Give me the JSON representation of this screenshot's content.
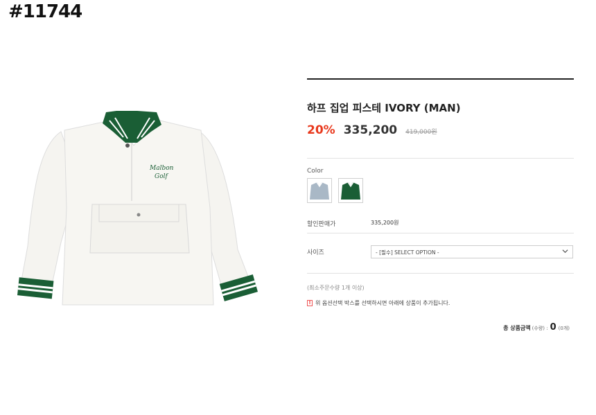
{
  "tag": "#11744",
  "product": {
    "title": "하프 집업 피스테 IVORY (MAN)",
    "discount": "20%",
    "sale_price": "335,200",
    "original_price": "419,000원",
    "image_logo_line1": "Malbon",
    "image_logo_line2": "Golf"
  },
  "color": {
    "label": "Color",
    "swatches": [
      "light-blue-jacket",
      "green-jacket"
    ]
  },
  "discount_price": {
    "label": "할인판매가",
    "value": "335,200원"
  },
  "size": {
    "label": "사이즈",
    "select_value": "- [필수] SELECT OPTION -"
  },
  "notes": {
    "min_qty": "(최소주문수량 1개 이상)",
    "alert_icon": "!",
    "alert_text": "위 옵션선택 박스를 선택하시면 아래에 상품이 추가됩니다."
  },
  "total": {
    "label": "총 상품금액",
    "sub": "(수량) :",
    "value": "0",
    "count": "(0개)"
  },
  "colors": {
    "accent_red": "#e8381c",
    "jacket_green": "#1a5e35",
    "swatch_blue": "#a9b8c6"
  }
}
